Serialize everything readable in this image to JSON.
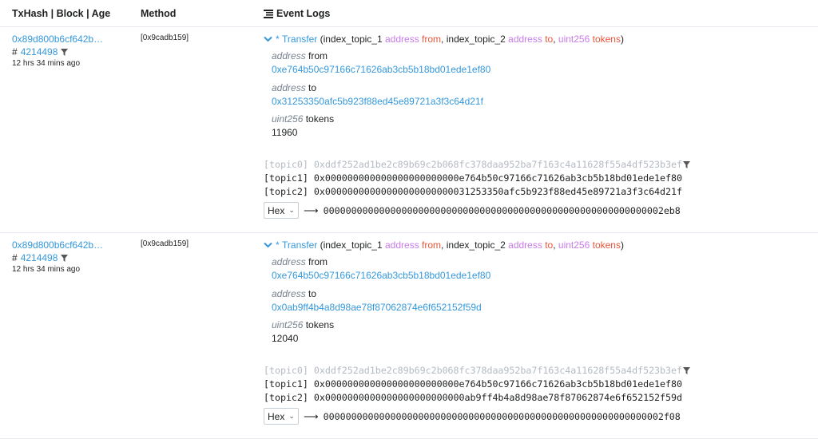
{
  "header": {
    "col_tx": "TxHash | Block | Age",
    "col_method": "Method",
    "col_logs": "Event Logs"
  },
  "rows": [
    {
      "txhash": "0x89d800b6cf642b…",
      "block_prefix": "#",
      "block": "4214498",
      "age": "12 hrs 34 mins ago",
      "method": "[0x9cadb159]",
      "event": {
        "star": "*",
        "name": "Transfer",
        "open": "(",
        "p1_name": "index_topic_1",
        "p1_type": "address",
        "p1_var": "from",
        "sep1": ",",
        "p2_name": "index_topic_2",
        "p2_type": "address",
        "p2_var": "to",
        "sep2": ",",
        "p3_type": "uint256",
        "p3_var": "tokens",
        "close": ")"
      },
      "params": [
        {
          "type": "address",
          "name": "from",
          "value": "0xe764b50c97166c71626ab3cb5b18bd01ede1ef80"
        },
        {
          "type": "address",
          "name": "to",
          "value": "0x31253350afc5b923f88ed45e89721a3f3c64d21f"
        },
        {
          "type": "uint256",
          "name": "tokens",
          "value": "11960"
        }
      ],
      "topics": [
        "[topic0] 0xddf252ad1be2c89b69c2b068fc378daa952ba7f163c4a11628f55a4df523b3ef",
        "[topic1] 0x000000000000000000000000e764b50c97166c71626ab3cb5b18bd01ede1ef80",
        "[topic2] 0x00000000000000000000000031253350afc5b923f88ed45e89721a3f3c64d21f"
      ],
      "data_format": "Hex",
      "data": "0000000000000000000000000000000000000000000000000000000000002eb8"
    },
    {
      "txhash": "0x89d800b6cf642b…",
      "block_prefix": "#",
      "block": "4214498",
      "age": "12 hrs 34 mins ago",
      "method": "[0x9cadb159]",
      "event": {
        "star": "*",
        "name": "Transfer",
        "open": "(",
        "p1_name": "index_topic_1",
        "p1_type": "address",
        "p1_var": "from",
        "sep1": ",",
        "p2_name": "index_topic_2",
        "p2_type": "address",
        "p2_var": "to",
        "sep2": ",",
        "p3_type": "uint256",
        "p3_var": "tokens",
        "close": ")"
      },
      "params": [
        {
          "type": "address",
          "name": "from",
          "value": "0xe764b50c97166c71626ab3cb5b18bd01ede1ef80"
        },
        {
          "type": "address",
          "name": "to",
          "value": "0x0ab9ff4b4a8d98ae78f87062874e6f652152f59d"
        },
        {
          "type": "uint256",
          "name": "tokens",
          "value": "12040"
        }
      ],
      "topics": [
        "[topic0] 0xddf252ad1be2c89b69c2b068fc378daa952ba7f163c4a11628f55a4df523b3ef",
        "[topic1] 0x000000000000000000000000e764b50c97166c71626ab3cb5b18bd01ede1ef80",
        "[topic2] 0x0000000000000000000000000ab9ff4b4a8d98ae78f87062874e6f652152f59d"
      ],
      "data_format": "Hex",
      "data": "0000000000000000000000000000000000000000000000000000000000002f08"
    }
  ],
  "icons": {
    "filter": "filter-icon",
    "list": "list-icon",
    "chevron": "chevron-down-icon",
    "arrow": "arrow-right-icon"
  },
  "colors": {
    "link": "#3498db",
    "type_keyword": "#c87be8",
    "var_name": "#e4563b",
    "muted": "#b4bac3"
  }
}
